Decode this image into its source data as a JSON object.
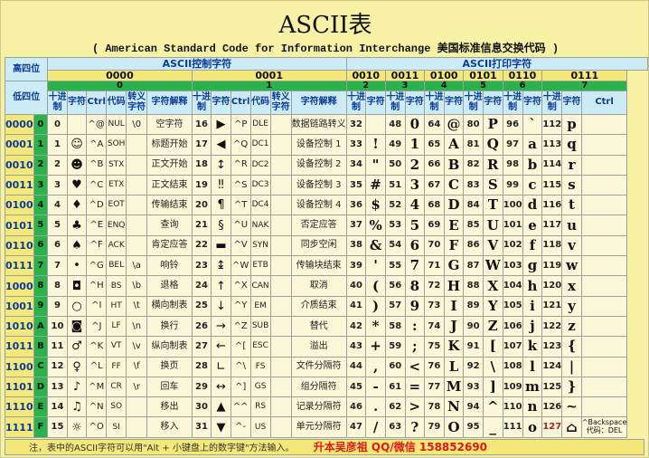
{
  "title": "ASCII表",
  "subtitle": "( American Standard Code for Information Interchange  美国标准信息交换代码 )",
  "header": {
    "high_label": "高四位",
    "low_label": "低四位",
    "control_group": "ASCII控制字符",
    "print_group": "ASCII打印字符",
    "high_bins": [
      "0000",
      "0001",
      "0010",
      "0011",
      "0100",
      "0101",
      "0110",
      "0111"
    ],
    "high_hex": [
      "0",
      "1",
      "2",
      "3",
      "4",
      "5",
      "6",
      "7"
    ],
    "ctrl_cols": [
      "十进制",
      "字符",
      "Ctrl",
      "代码",
      "转义字符",
      "字符解释"
    ],
    "print_cols": [
      "十进制",
      "字符"
    ],
    "ctrl7": "Ctrl"
  },
  "rows": [
    {
      "bin": "0000",
      "hex": "0",
      "g0": {
        "dec": "0",
        "chr": "",
        "ctrl": "^@",
        "code": "NUL",
        "esc": "\\0",
        "desc": "空字符"
      },
      "g1": {
        "dec": "16",
        "chr": "▶",
        "ctrl": "^P",
        "code": "DLE",
        "esc": "",
        "desc": "数据链路转义"
      },
      "p": [
        [
          "32",
          ""
        ],
        [
          "48",
          "0"
        ],
        [
          "64",
          "@"
        ],
        [
          "80",
          "P"
        ],
        [
          "96",
          "`"
        ],
        [
          "112",
          "p"
        ]
      ]
    },
    {
      "bin": "0001",
      "hex": "1",
      "g0": {
        "dec": "1",
        "chr": "☺",
        "ctrl": "^A",
        "code": "SOH",
        "esc": "",
        "desc": "标题开始"
      },
      "g1": {
        "dec": "17",
        "chr": "◀",
        "ctrl": "^Q",
        "code": "DC1",
        "esc": "",
        "desc": "设备控制 1"
      },
      "p": [
        [
          "33",
          "!"
        ],
        [
          "49",
          "1"
        ],
        [
          "65",
          "A"
        ],
        [
          "81",
          "Q"
        ],
        [
          "97",
          "a"
        ],
        [
          "113",
          "q"
        ]
      ]
    },
    {
      "bin": "0010",
      "hex": "2",
      "g0": {
        "dec": "2",
        "chr": "☻",
        "ctrl": "^B",
        "code": "STX",
        "esc": "",
        "desc": "正文开始"
      },
      "g1": {
        "dec": "18",
        "chr": "↕",
        "ctrl": "^R",
        "code": "DC2",
        "esc": "",
        "desc": "设备控制 2"
      },
      "p": [
        [
          "34",
          "\""
        ],
        [
          "50",
          "2"
        ],
        [
          "66",
          "B"
        ],
        [
          "82",
          "R"
        ],
        [
          "98",
          "b"
        ],
        [
          "114",
          "r"
        ]
      ]
    },
    {
      "bin": "0011",
      "hex": "3",
      "g0": {
        "dec": "3",
        "chr": "♥",
        "ctrl": "^C",
        "code": "ETX",
        "esc": "",
        "desc": "正文结束"
      },
      "g1": {
        "dec": "19",
        "chr": "‼",
        "ctrl": "^S",
        "code": "DC3",
        "esc": "",
        "desc": "设备控制 3"
      },
      "p": [
        [
          "35",
          "#"
        ],
        [
          "51",
          "3"
        ],
        [
          "67",
          "C"
        ],
        [
          "83",
          "S"
        ],
        [
          "99",
          "c"
        ],
        [
          "115",
          "s"
        ]
      ]
    },
    {
      "bin": "0100",
      "hex": "4",
      "g0": {
        "dec": "4",
        "chr": "♦",
        "ctrl": "^D",
        "code": "EOT",
        "esc": "",
        "desc": "传输结束"
      },
      "g1": {
        "dec": "20",
        "chr": "¶",
        "ctrl": "^T",
        "code": "DC4",
        "esc": "",
        "desc": "设备控制 4"
      },
      "p": [
        [
          "36",
          "$"
        ],
        [
          "52",
          "4"
        ],
        [
          "68",
          "D"
        ],
        [
          "84",
          "T"
        ],
        [
          "100",
          "d"
        ],
        [
          "116",
          "t"
        ]
      ]
    },
    {
      "bin": "0101",
      "hex": "5",
      "g0": {
        "dec": "5",
        "chr": "♣",
        "ctrl": "^E",
        "code": "ENQ",
        "esc": "",
        "desc": "查询"
      },
      "g1": {
        "dec": "21",
        "chr": "§",
        "ctrl": "^U",
        "code": "NAK",
        "esc": "",
        "desc": "否定应答"
      },
      "p": [
        [
          "37",
          "%"
        ],
        [
          "53",
          "5"
        ],
        [
          "69",
          "E"
        ],
        [
          "85",
          "U"
        ],
        [
          "101",
          "e"
        ],
        [
          "117",
          "u"
        ]
      ]
    },
    {
      "bin": "0110",
      "hex": "6",
      "g0": {
        "dec": "6",
        "chr": "♠",
        "ctrl": "^F",
        "code": "ACK",
        "esc": "",
        "desc": "肯定应答"
      },
      "g1": {
        "dec": "22",
        "chr": "▬",
        "ctrl": "^V",
        "code": "SYN",
        "esc": "",
        "desc": "同步空闲"
      },
      "p": [
        [
          "38",
          "&"
        ],
        [
          "54",
          "6"
        ],
        [
          "70",
          "F"
        ],
        [
          "86",
          "V"
        ],
        [
          "102",
          "f"
        ],
        [
          "118",
          "v"
        ]
      ]
    },
    {
      "bin": "0111",
      "hex": "7",
      "g0": {
        "dec": "7",
        "chr": "•",
        "ctrl": "^G",
        "code": "BEL",
        "esc": "\\a",
        "desc": "响铃"
      },
      "g1": {
        "dec": "23",
        "chr": "↨",
        "ctrl": "^W",
        "code": "ETB",
        "esc": "",
        "desc": "传输块结束"
      },
      "p": [
        [
          "39",
          "'"
        ],
        [
          "55",
          "7"
        ],
        [
          "71",
          "G"
        ],
        [
          "87",
          "W"
        ],
        [
          "103",
          "g"
        ],
        [
          "119",
          "w"
        ]
      ]
    },
    {
      "bin": "1000",
      "hex": "8",
      "g0": {
        "dec": "8",
        "chr": "◘",
        "ctrl": "^H",
        "code": "BS",
        "esc": "\\b",
        "desc": "退格"
      },
      "g1": {
        "dec": "24",
        "chr": "↑",
        "ctrl": "^X",
        "code": "CAN",
        "esc": "",
        "desc": "取消"
      },
      "p": [
        [
          "40",
          "("
        ],
        [
          "56",
          "8"
        ],
        [
          "72",
          "H"
        ],
        [
          "88",
          "X"
        ],
        [
          "104",
          "h"
        ],
        [
          "120",
          "x"
        ]
      ]
    },
    {
      "bin": "1001",
      "hex": "9",
      "g0": {
        "dec": "9",
        "chr": "○",
        "ctrl": "^I",
        "code": "HT",
        "esc": "\\t",
        "desc": "横向制表"
      },
      "g1": {
        "dec": "25",
        "chr": "↓",
        "ctrl": "^Y",
        "code": "EM",
        "esc": "",
        "desc": "介质结束"
      },
      "p": [
        [
          "41",
          ")"
        ],
        [
          "57",
          "9"
        ],
        [
          "73",
          "I"
        ],
        [
          "89",
          "Y"
        ],
        [
          "105",
          "i"
        ],
        [
          "121",
          "y"
        ]
      ]
    },
    {
      "bin": "1010",
      "hex": "A",
      "g0": {
        "dec": "10",
        "chr": "◙",
        "ctrl": "^J",
        "code": "LF",
        "esc": "\\n",
        "desc": "换行"
      },
      "g1": {
        "dec": "26",
        "chr": "→",
        "ctrl": "^Z",
        "code": "SUB",
        "esc": "",
        "desc": "替代"
      },
      "p": [
        [
          "42",
          "*"
        ],
        [
          "58",
          ":"
        ],
        [
          "74",
          "J"
        ],
        [
          "90",
          "Z"
        ],
        [
          "106",
          "j"
        ],
        [
          "122",
          "z"
        ]
      ]
    },
    {
      "bin": "1011",
      "hex": "B",
      "g0": {
        "dec": "11",
        "chr": "♂",
        "ctrl": "^K",
        "code": "VT",
        "esc": "\\v",
        "desc": "纵向制表"
      },
      "g1": {
        "dec": "27",
        "chr": "←",
        "ctrl": "^[",
        "code": "ESC",
        "esc": "",
        "desc": "溢出"
      },
      "p": [
        [
          "43",
          "+"
        ],
        [
          "59",
          ";"
        ],
        [
          "75",
          "K"
        ],
        [
          "91",
          "["
        ],
        [
          "107",
          "k"
        ],
        [
          "123",
          "{"
        ]
      ]
    },
    {
      "bin": "1100",
      "hex": "C",
      "g0": {
        "dec": "12",
        "chr": "♀",
        "ctrl": "^L",
        "code": "FF",
        "esc": "\\f",
        "desc": "换页"
      },
      "g1": {
        "dec": "28",
        "chr": "∟",
        "ctrl": "^\\",
        "code": "FS",
        "esc": "",
        "desc": "文件分隔符"
      },
      "p": [
        [
          "44",
          ","
        ],
        [
          "60",
          "<"
        ],
        [
          "76",
          "L"
        ],
        [
          "92",
          "\\"
        ],
        [
          "108",
          "l"
        ],
        [
          "124",
          "|"
        ]
      ]
    },
    {
      "bin": "1101",
      "hex": "D",
      "g0": {
        "dec": "13",
        "chr": "♪",
        "ctrl": "^M",
        "code": "CR",
        "esc": "\\r",
        "desc": "回车"
      },
      "g1": {
        "dec": "29",
        "chr": "↔",
        "ctrl": "^]",
        "code": "GS",
        "esc": "",
        "desc": "组分隔符"
      },
      "p": [
        [
          "45",
          "-"
        ],
        [
          "61",
          "="
        ],
        [
          "77",
          "M"
        ],
        [
          "93",
          "]"
        ],
        [
          "109",
          "m"
        ],
        [
          "125",
          "}"
        ]
      ]
    },
    {
      "bin": "1110",
      "hex": "E",
      "g0": {
        "dec": "14",
        "chr": "♫",
        "ctrl": "^N",
        "code": "SO",
        "esc": "",
        "desc": "移出"
      },
      "g1": {
        "dec": "30",
        "chr": "▲",
        "ctrl": "^^",
        "code": "RS",
        "esc": "",
        "desc": "记录分隔符"
      },
      "p": [
        [
          "46",
          "."
        ],
        [
          "62",
          ">"
        ],
        [
          "78",
          "N"
        ],
        [
          "94",
          "^"
        ],
        [
          "110",
          "n"
        ],
        [
          "126",
          "~"
        ]
      ]
    },
    {
      "bin": "1111",
      "hex": "F",
      "g0": {
        "dec": "15",
        "chr": "☼",
        "ctrl": "^O",
        "code": "SI",
        "esc": "",
        "desc": "移入"
      },
      "g1": {
        "dec": "31",
        "chr": "▼",
        "ctrl": "^-",
        "code": "US",
        "esc": "",
        "desc": "单元分隔符"
      },
      "p": [
        [
          "47",
          "/"
        ],
        [
          "63",
          "?"
        ],
        [
          "79",
          "O"
        ],
        [
          "95",
          "_"
        ],
        [
          "111",
          "o"
        ],
        [
          "127",
          "⌂"
        ]
      ]
    }
  ],
  "extra_last": "^Backspace 代码：DEL",
  "footer": {
    "note": "注，表中的ASCII字符可以用\"Alt + 小键盘上的数字键\"方法输入。",
    "promo": "升本吴彦祖 QQ/微信 158852690"
  }
}
